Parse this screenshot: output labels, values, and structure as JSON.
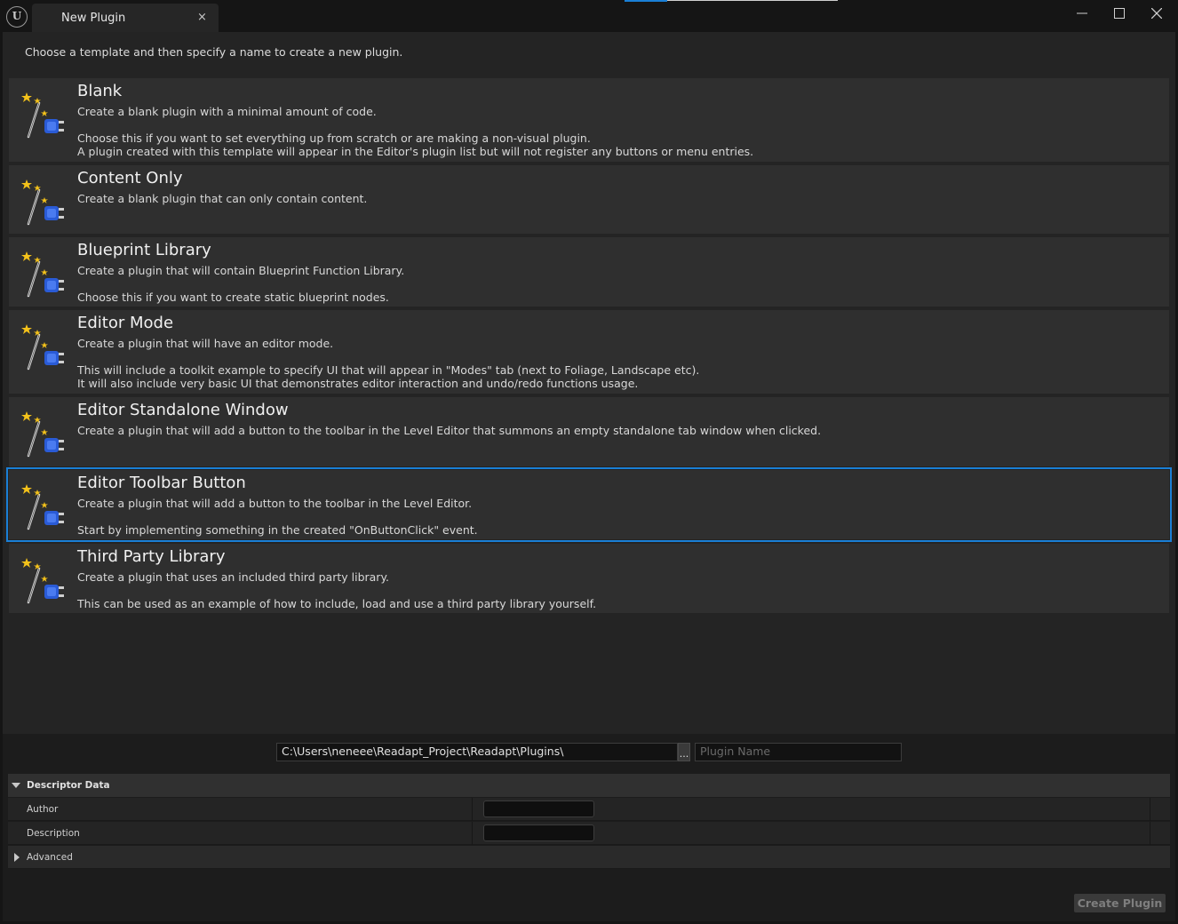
{
  "window": {
    "tab_title": "New Plugin",
    "tab_close": "×",
    "logo_text": "U",
    "minimize": "—",
    "maximize": "☐",
    "close": "✕"
  },
  "intro": "Choose a template and then specify a name to create a new plugin.",
  "templates": [
    {
      "title": "Blank",
      "desc": "Create a blank plugin with a minimal amount of code.",
      "more": "Choose this if you want to set everything up from scratch or are making a non-visual plugin.\nA plugin created with this template will appear in the Editor's plugin list but will not register any buttons or menu entries."
    },
    {
      "title": "Content Only",
      "desc": "Create a blank plugin that can only contain content.",
      "more": ""
    },
    {
      "title": "Blueprint Library",
      "desc": "Create a plugin that will contain Blueprint Function Library.",
      "more": "Choose this if you want to create static blueprint nodes."
    },
    {
      "title": "Editor Mode",
      "desc": "Create a plugin that will have an editor mode.",
      "more": "This will include a toolkit example to specify UI that will appear in \"Modes\" tab (next to Foliage, Landscape etc).\nIt will also include very basic UI that demonstrates editor interaction and undo/redo functions usage."
    },
    {
      "title": "Editor Standalone Window",
      "desc": "Create a plugin that will add a button to the toolbar in the Level Editor that summons an empty standalone tab window when clicked.",
      "more": ""
    },
    {
      "title": "Editor Toolbar Button",
      "desc": "Create a plugin that will add a button to the toolbar in the Level Editor.",
      "more": "Start by implementing something in the created \"OnButtonClick\" event.",
      "selected": true
    },
    {
      "title": "Third Party Library",
      "desc": "Create a plugin that uses an included third party library.",
      "more": "This can be used as an example of how to include, load and use a third party library yourself."
    }
  ],
  "path": {
    "value": "C:\\Users\\neneee\\Readapt_Project\\Readapt\\Plugins\\",
    "browse_label": "...",
    "name_placeholder": "Plugin Name",
    "name_value": ""
  },
  "descriptor": {
    "header": "Descriptor Data",
    "author_label": "Author",
    "author_value": "",
    "description_label": "Description",
    "description_value": "",
    "advanced_label": "Advanced"
  },
  "create_button": "Create Plugin",
  "colors": {
    "accent": "#1a7fd6",
    "background": "#242424",
    "card": "#2f2f2f"
  }
}
